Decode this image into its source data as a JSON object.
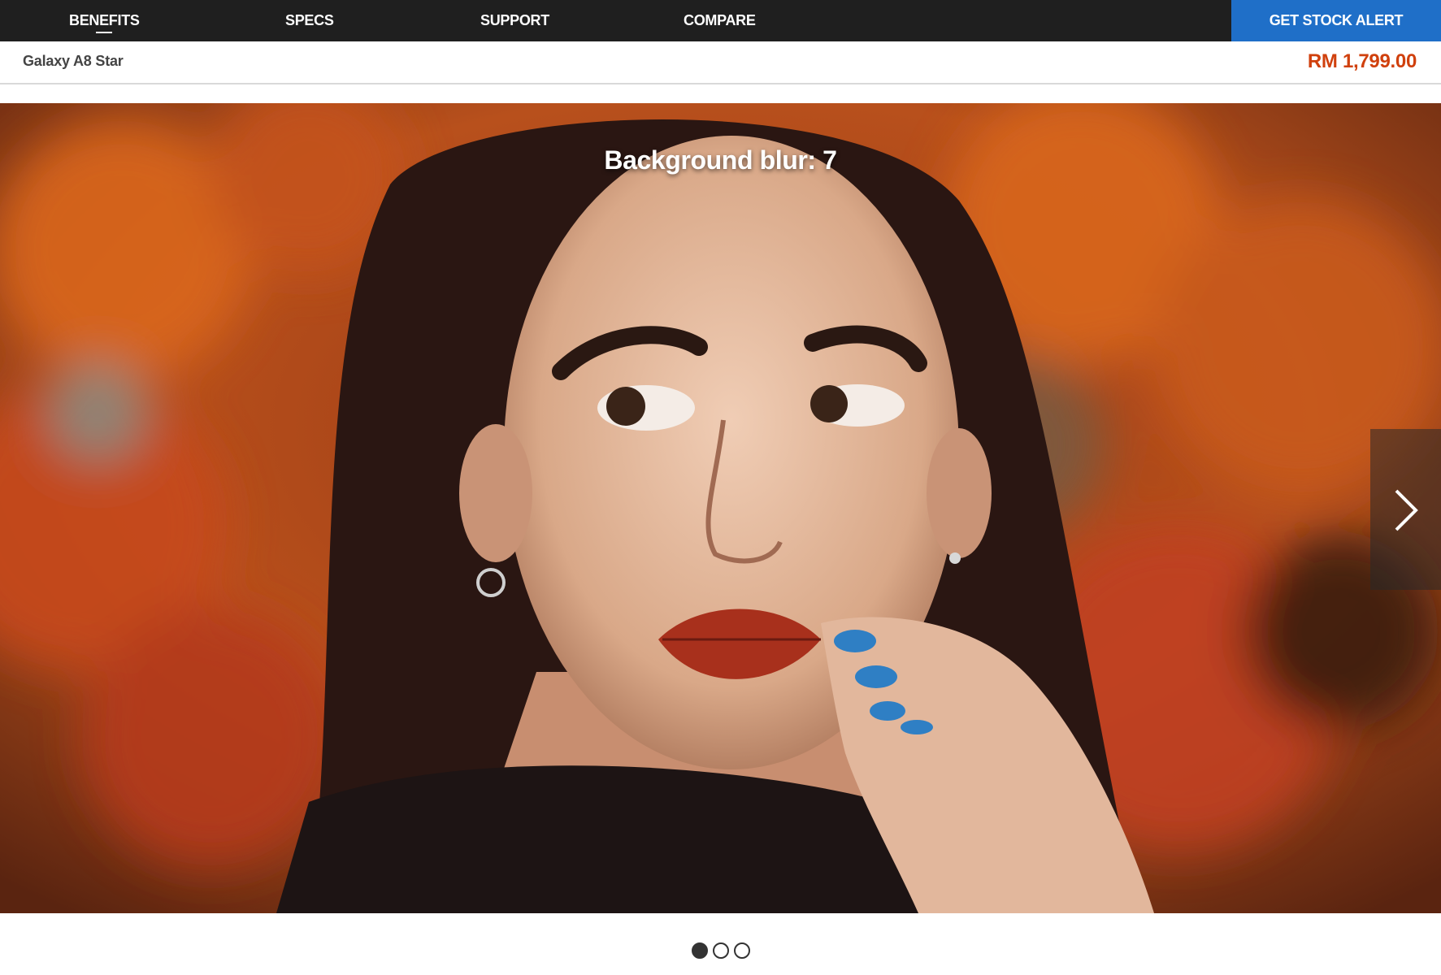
{
  "nav": {
    "tabs": [
      {
        "label": "BENEFITS",
        "active": true
      },
      {
        "label": "SPECS",
        "active": false
      },
      {
        "label": "SUPPORT",
        "active": false
      },
      {
        "label": "COMPARE",
        "active": false
      }
    ],
    "cta_label": "GET STOCK ALERT"
  },
  "product": {
    "name": "Galaxy A8 Star",
    "price": "RM 1,799.00"
  },
  "hero": {
    "caption": "Background blur: 7",
    "next_icon": "chevron-right-icon"
  },
  "pagination": {
    "total": 3,
    "active_index": 0
  },
  "colors": {
    "nav_bg": "#1f1f1f",
    "cta_bg": "#1f6fc8",
    "price": "#d0400d"
  }
}
